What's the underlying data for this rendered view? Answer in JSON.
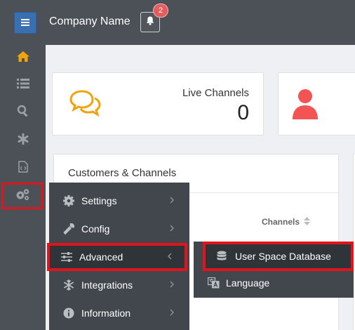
{
  "header": {
    "menu_icon": "hamburger-icon",
    "company_name": "Company Name",
    "notification_count": "2",
    "bell_icon": "bell-icon"
  },
  "sidebar": {
    "items": [
      {
        "icon": "home-icon",
        "color": "#f0a30a"
      },
      {
        "icon": "list-icon"
      },
      {
        "icon": "search-icon"
      },
      {
        "icon": "asterisk-icon"
      },
      {
        "icon": "code-file-icon"
      },
      {
        "icon": "gears-icon",
        "selected": true
      }
    ]
  },
  "stats": {
    "live_channels_label": "Live Channels",
    "live_channels_value": "0"
  },
  "customers_card": {
    "title": "Customers & Channels",
    "channels_header": "Channels"
  },
  "dropdown": {
    "items": [
      {
        "label": "Settings",
        "icon": "gear-icon"
      },
      {
        "label": "Config",
        "icon": "wrench-icon"
      },
      {
        "label": "Advanced",
        "icon": "sliders-icon",
        "selected": true
      },
      {
        "label": "Integrations",
        "icon": "snowflake-icon"
      },
      {
        "label": "Information",
        "icon": "info-icon"
      }
    ]
  },
  "submenu": {
    "items": [
      {
        "label": "User Space Database",
        "icon": "database-icon",
        "selected": true
      },
      {
        "label": "Language",
        "icon": "language-icon"
      }
    ]
  },
  "colors": {
    "accent": "#3a6fb0",
    "highlight": "#e1141e",
    "warning": "#f0a30a",
    "danger": "#f25454"
  }
}
